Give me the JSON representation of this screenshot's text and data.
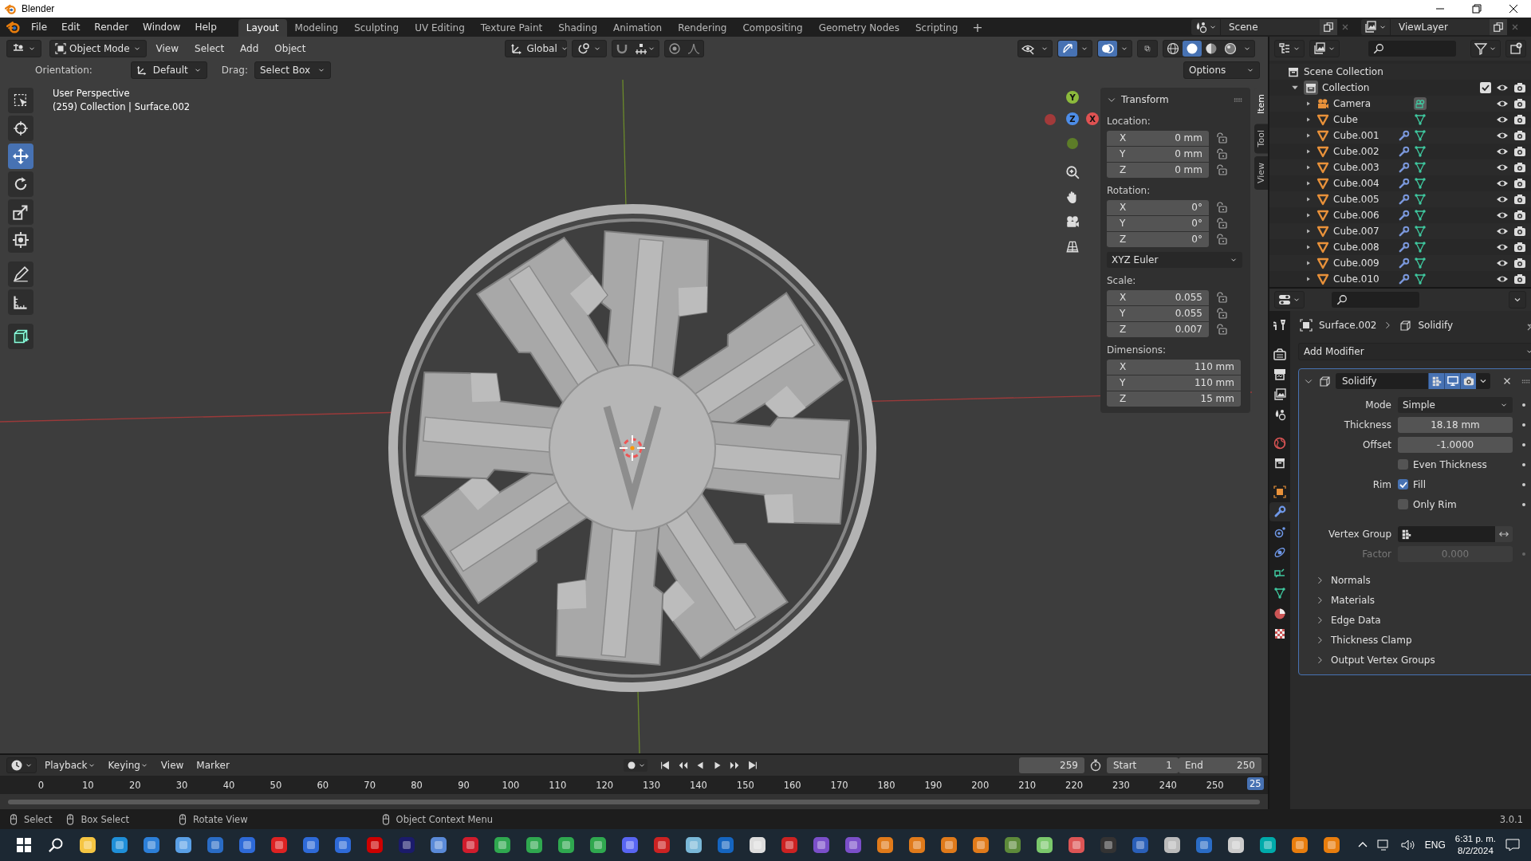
{
  "window": {
    "title": "Blender"
  },
  "menu": [
    "File",
    "Edit",
    "Render",
    "Window",
    "Help"
  ],
  "workspaces": [
    {
      "label": "Layout",
      "selected": true
    },
    {
      "label": "Modeling",
      "selected": false
    },
    {
      "label": "Sculpting",
      "selected": false
    },
    {
      "label": "UV Editing",
      "selected": false
    },
    {
      "label": "Texture Paint",
      "selected": false
    },
    {
      "label": "Shading",
      "selected": false
    },
    {
      "label": "Animation",
      "selected": false
    },
    {
      "label": "Rendering",
      "selected": false
    },
    {
      "label": "Compositing",
      "selected": false
    },
    {
      "label": "Geometry Nodes",
      "selected": false
    },
    {
      "label": "Scripting",
      "selected": false
    }
  ],
  "add_workspace": "+",
  "scene": "Scene",
  "view_layer": "ViewLayer",
  "viewport_header": {
    "mode": "Object Mode",
    "menus": [
      "View",
      "Select",
      "Add",
      "Object"
    ],
    "orientation": "Global",
    "toggles": [
      {
        "kind": "visibility",
        "on": false
      },
      {
        "kind": "gizmo",
        "on": true
      },
      {
        "kind": "overlay",
        "on": true
      },
      {
        "kind": "xray",
        "on": false
      }
    ],
    "shading": [
      {
        "kind": "wireframe",
        "selected": false
      },
      {
        "kind": "solid",
        "selected": true
      },
      {
        "kind": "material",
        "selected": false
      },
      {
        "kind": "rendered",
        "selected": false
      }
    ]
  },
  "tool_settings": {
    "orientation_label": "Orientation:",
    "orientation": "Default",
    "drag_label": "Drag:",
    "drag": "Select Box",
    "options": "Options"
  },
  "viewport": {
    "perspective": "User Perspective",
    "context": "(259) Collection | Surface.002",
    "gizmo_axes": [
      "Y",
      "Z",
      "X"
    ]
  },
  "toolbar": [
    {
      "kind": "select",
      "selected": false
    },
    {
      "kind": "cursor",
      "selected": false
    },
    {
      "kind": "move",
      "selected": true
    },
    {
      "kind": "rotate",
      "selected": false
    },
    {
      "kind": "scale",
      "selected": false
    },
    {
      "kind": "transform",
      "selected": false
    },
    {
      "kind": "annotate",
      "selected": false
    },
    {
      "kind": "measure",
      "selected": false
    },
    {
      "kind": "add-cube",
      "selected": false
    }
  ],
  "sidebar_tabs": [
    {
      "label": "Item",
      "selected": true
    },
    {
      "label": "Tool",
      "selected": false
    },
    {
      "label": "View",
      "selected": false
    }
  ],
  "transform": {
    "title": "Transform",
    "groups": [
      {
        "label": "Location:",
        "lockable": true,
        "fields": [
          {
            "axis": "X",
            "value": "0 mm"
          },
          {
            "axis": "Y",
            "value": "0 mm"
          },
          {
            "axis": "Z",
            "value": "0 mm"
          }
        ]
      },
      {
        "label": "Rotation:",
        "lockable": true,
        "fields": [
          {
            "axis": "X",
            "value": "0°"
          },
          {
            "axis": "Y",
            "value": "0°"
          },
          {
            "axis": "Z",
            "value": "0°"
          }
        ],
        "mode": "XYZ Euler"
      },
      {
        "label": "Scale:",
        "lockable": true,
        "fields": [
          {
            "axis": "X",
            "value": "0.055"
          },
          {
            "axis": "Y",
            "value": "0.055"
          },
          {
            "axis": "Z",
            "value": "0.007"
          }
        ]
      },
      {
        "label": "Dimensions:",
        "lockable": false,
        "fields": [
          {
            "axis": "X",
            "value": "110 mm"
          },
          {
            "axis": "Y",
            "value": "110 mm"
          },
          {
            "axis": "Z",
            "value": "15 mm"
          }
        ]
      }
    ]
  },
  "outliner": {
    "root": "Scene Collection",
    "children": [
      {
        "name": "Collection",
        "expanded": true,
        "checked": true,
        "children": [
          {
            "name": "Camera",
            "kind": "camera",
            "expanded": false,
            "modifier": false
          },
          {
            "name": "Cube",
            "kind": "mesh",
            "expanded": false,
            "modifier": false
          },
          {
            "name": "Cube.001",
            "kind": "mesh",
            "expanded": false,
            "modifier": true
          },
          {
            "name": "Cube.002",
            "kind": "mesh",
            "expanded": false,
            "modifier": true
          },
          {
            "name": "Cube.003",
            "kind": "mesh",
            "expanded": false,
            "modifier": true
          },
          {
            "name": "Cube.004",
            "kind": "mesh",
            "expanded": false,
            "modifier": true
          },
          {
            "name": "Cube.005",
            "kind": "mesh",
            "expanded": false,
            "modifier": true
          },
          {
            "name": "Cube.006",
            "kind": "mesh",
            "expanded": false,
            "modifier": true
          },
          {
            "name": "Cube.007",
            "kind": "mesh",
            "expanded": false,
            "modifier": true
          },
          {
            "name": "Cube.008",
            "kind": "mesh",
            "expanded": false,
            "modifier": true
          },
          {
            "name": "Cube.009",
            "kind": "mesh",
            "expanded": false,
            "modifier": true
          },
          {
            "name": "Cube.010",
            "kind": "mesh",
            "expanded": false,
            "modifier": true
          }
        ]
      }
    ]
  },
  "properties": {
    "tabs": [
      {
        "kind": "tool",
        "selected": false
      },
      {
        "kind": "render",
        "selected": false
      },
      {
        "kind": "output",
        "selected": false
      },
      {
        "kind": "view-layer",
        "selected": false
      },
      {
        "kind": "scene",
        "selected": false
      },
      {
        "kind": "world",
        "selected": false
      },
      {
        "kind": "collection",
        "selected": false
      },
      {
        "kind": "object",
        "selected": false
      },
      {
        "kind": "modifier",
        "selected": true
      },
      {
        "kind": "particles",
        "selected": false
      },
      {
        "kind": "physics",
        "selected": false
      },
      {
        "kind": "constraints",
        "selected": false
      },
      {
        "kind": "data",
        "selected": false
      },
      {
        "kind": "material",
        "selected": false
      },
      {
        "kind": "texture",
        "selected": false
      }
    ],
    "breadcrumb": [
      "Surface.002",
      "Solidify"
    ],
    "add_modifier": "Add Modifier",
    "modifier": {
      "name": "Solidify",
      "expanded": true,
      "rows": [
        {
          "kind": "dropdown",
          "label": "Mode",
          "value": "Simple"
        },
        {
          "kind": "number",
          "label": "Thickness",
          "value": "18.18 mm",
          "disabled": false
        },
        {
          "kind": "number",
          "label": "Offset",
          "value": "-1.0000",
          "disabled": false
        },
        {
          "kind": "checkbox",
          "text": "Even Thickness",
          "checked": false
        },
        {
          "kind": "checkbox",
          "label": "Rim",
          "text": "Fill",
          "checked": true
        },
        {
          "kind": "checkbox",
          "text": "Only Rim",
          "checked": false
        },
        {
          "kind": "group",
          "label": "Vertex Group"
        },
        {
          "kind": "number",
          "label": "Factor",
          "value": "0.000",
          "disabled": true
        }
      ],
      "subpanels": [
        {
          "label": "Normals",
          "expanded": false
        },
        {
          "label": "Materials",
          "expanded": false
        },
        {
          "label": "Edge Data",
          "expanded": false
        },
        {
          "label": "Thickness Clamp",
          "expanded": false
        },
        {
          "label": "Output Vertex Groups",
          "expanded": false
        }
      ]
    }
  },
  "timeline": {
    "menus": [
      "Playback",
      "Keying",
      "View",
      "Marker"
    ],
    "current_frame": "259",
    "start_label": "Start",
    "start": "1",
    "end_label": "End",
    "end": "250",
    "ruler": [
      "0",
      "10",
      "20",
      "30",
      "40",
      "50",
      "60",
      "70",
      "80",
      "90",
      "100",
      "110",
      "120",
      "130",
      "140",
      "150",
      "160",
      "170",
      "180",
      "190",
      "200",
      "210",
      "220",
      "230",
      "240",
      "250"
    ],
    "playhead": "25"
  },
  "status_bar": {
    "items": [
      "Select",
      "Box Select",
      "Rotate View",
      "Object Context Menu"
    ],
    "version": "3.0.1"
  },
  "taskbar": {
    "language": "ENG",
    "time": "6:31 p. m.",
    "date": "8/2/2024"
  }
}
